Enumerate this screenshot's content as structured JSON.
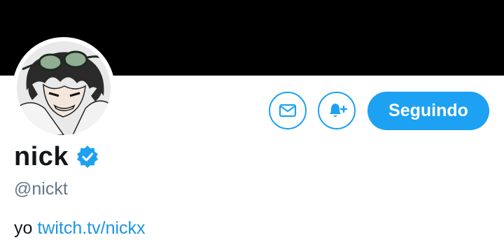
{
  "profile": {
    "display_name": "nick",
    "handle": "@nickt",
    "bio_text": "yo",
    "bio_link": "twitch.tv/nickx"
  },
  "actions": {
    "message_icon": "envelope-icon",
    "notify_icon": "bell-plus-icon",
    "follow_label": "Seguindo"
  },
  "colors": {
    "accent": "#1da1f2",
    "link": "#1b95e0",
    "banner": "#000000",
    "handle": "#657786",
    "text": "#14171a"
  }
}
